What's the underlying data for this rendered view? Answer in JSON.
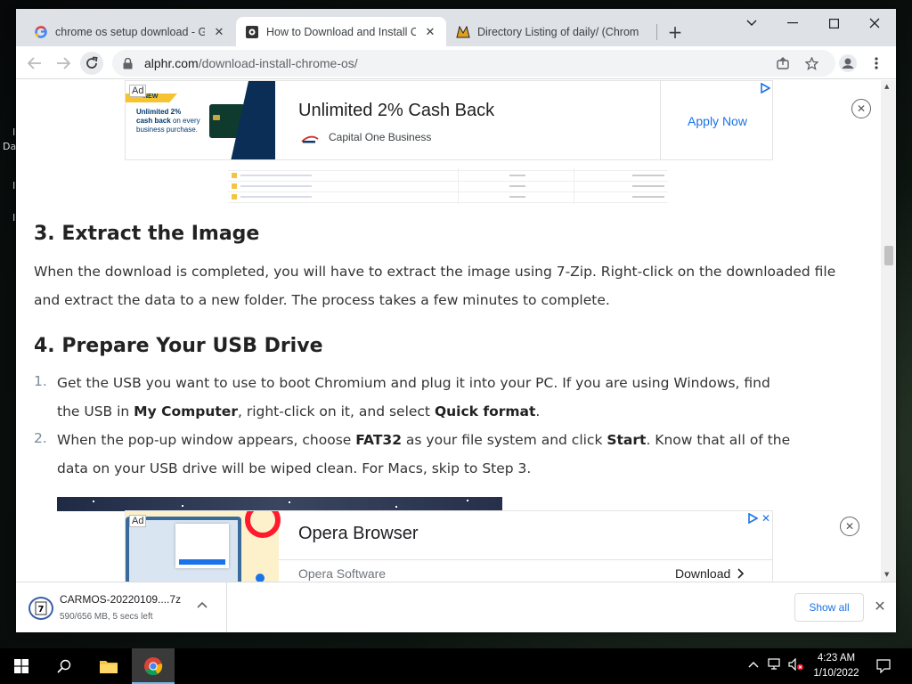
{
  "browser": {
    "tabs": [
      {
        "title": "chrome os setup download - Go",
        "favicon": "google-g-icon",
        "active": false
      },
      {
        "title": "How to Download and Install Ch",
        "favicon": "alphr-icon",
        "active": true
      },
      {
        "title": "Directory Listing of daily/ (Chrom",
        "favicon": "arnold-icon",
        "active": false
      }
    ],
    "new_tab_label": "+",
    "url_host": "alphr.com",
    "url_path": "/download-install-chrome-os/"
  },
  "ad_top": {
    "label": "Ad",
    "card_badge": "NEW",
    "card_line1": "Unlimited 2%",
    "card_line2": "cash back",
    "card_line3": "on every business purchase.",
    "headline": "Unlimited 2% Cash Back",
    "advertiser": "Capital One Business",
    "cta": "Apply Now"
  },
  "article": {
    "section3_heading": "3. Extract the Image",
    "section3_text": "When the download is completed, you will have to extract the image using 7-Zip. Right-click on the downloaded file and extract the data to a new folder. The process takes a few minutes to complete.",
    "section4_heading": "4. Prepare Your USB Drive",
    "steps": [
      {
        "num": "1.",
        "line1_a": "Get the USB you want to use to boot Chromium and plug it into your PC. If you are using Windows, find",
        "line2_a": "the USB in ",
        "line2_b1": "My Computer",
        "line2_c": ", right-click on it, and select ",
        "line2_b2": "Quick format",
        "line2_d": "."
      },
      {
        "num": "2.",
        "line1_a": "When the pop-up window appears, choose ",
        "line1_b1": "FAT32",
        "line1_c": " as your file system and click ",
        "line1_b2": "Start",
        "line1_d": ". Know that all of the",
        "line2_a": "data on your USB drive will be wiped clean. For Macs, skip to Step 3."
      }
    ]
  },
  "ad_bottom": {
    "label": "Ad",
    "headline": "Opera Browser",
    "advertiser": "Opera Software",
    "cta": "Download"
  },
  "download": {
    "filename": "CARMOS-20220109....7z",
    "status": "590/656 MB, 5 secs left",
    "show_all": "Show all"
  },
  "taskbar": {
    "time": "4:23 AM",
    "date": "1/10/2022"
  },
  "colors": {
    "accent": "#1a73e8",
    "tabstrip": "#dee1e6",
    "list_number": "#7b8aa0"
  }
}
